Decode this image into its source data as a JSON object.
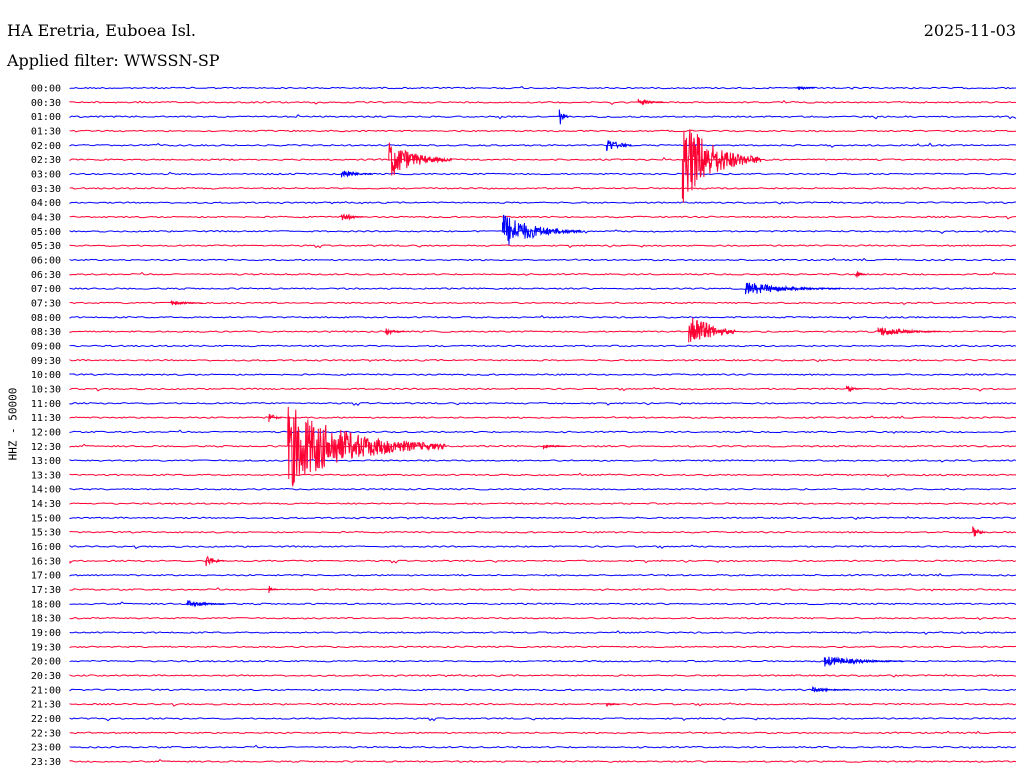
{
  "header": {
    "station": "HA Eretria, Euboea Isl.",
    "date": "2025-11-03",
    "filter": "Applied filter: WWSSN-SP"
  },
  "chart_data": {
    "type": "line",
    "title": "HA Eretria, Euboea Isl.",
    "ylabel": "HHZ - 50000",
    "date": "2025-11-03",
    "filter": "WWSSN-SP",
    "grid": false,
    "colors": {
      "even_rows": "#0000ff",
      "odd_rows": "#ff0033"
    },
    "rows": [
      "00:00",
      "00:30",
      "01:00",
      "01:30",
      "02:00",
      "02:30",
      "03:00",
      "03:30",
      "04:00",
      "04:30",
      "05:00",
      "05:30",
      "06:00",
      "06:30",
      "07:00",
      "07:30",
      "08:00",
      "08:30",
      "09:00",
      "09:30",
      "10:00",
      "10:30",
      "11:00",
      "11:30",
      "12:00",
      "12:30",
      "13:00",
      "13:30",
      "14:00",
      "14:30",
      "15:00",
      "15:30",
      "16:00",
      "16:30",
      "17:00",
      "17:30",
      "18:00",
      "18:30",
      "19:00",
      "19:30",
      "20:00",
      "20:30",
      "21:00",
      "21:30",
      "22:00",
      "22:30",
      "23:00",
      "23:30"
    ],
    "row_minutes": 30,
    "events": [
      {
        "row": "00:30",
        "minute": 18.0,
        "amp": 0.3,
        "dur": 0.8
      },
      {
        "row": "01:00",
        "minute": 15.5,
        "amp": 0.7,
        "dur": 0.3
      },
      {
        "row": "00:00",
        "minute": 23.0,
        "amp": 0.2,
        "dur": 0.6
      },
      {
        "row": "02:00",
        "minute": 17.0,
        "amp": 0.6,
        "dur": 0.8
      },
      {
        "row": "02:30",
        "minute": 10.1,
        "amp": 1.4,
        "dur": 2.0
      },
      {
        "row": "02:30",
        "minute": 19.4,
        "amp": 3.2,
        "dur": 2.5
      },
      {
        "row": "03:00",
        "minute": 8.6,
        "amp": 0.4,
        "dur": 1.0
      },
      {
        "row": "04:30",
        "minute": 8.6,
        "amp": 0.4,
        "dur": 0.7
      },
      {
        "row": "05:00",
        "minute": 13.7,
        "amp": 1.3,
        "dur": 2.5
      },
      {
        "row": "06:30",
        "minute": 24.9,
        "amp": 0.3,
        "dur": 0.3
      },
      {
        "row": "07:00",
        "minute": 21.4,
        "amp": 0.5,
        "dur": 3.0
      },
      {
        "row": "07:30",
        "minute": 3.2,
        "amp": 0.2,
        "dur": 1.0
      },
      {
        "row": "08:30",
        "minute": 19.6,
        "amp": 1.7,
        "dur": 1.5
      },
      {
        "row": "08:30",
        "minute": 25.6,
        "amp": 0.4,
        "dur": 2.0
      },
      {
        "row": "08:30",
        "minute": 10.0,
        "amp": 0.3,
        "dur": 0.6
      },
      {
        "row": "10:30",
        "minute": 24.6,
        "amp": 0.3,
        "dur": 0.5
      },
      {
        "row": "11:30",
        "minute": 6.3,
        "amp": 0.4,
        "dur": 0.4
      },
      {
        "row": "12:30",
        "minute": 6.9,
        "amp": 3.0,
        "dur": 5.0
      },
      {
        "row": "12:30",
        "minute": 15.0,
        "amp": 0.2,
        "dur": 0.7
      },
      {
        "row": "15:30",
        "minute": 28.6,
        "amp": 0.5,
        "dur": 0.4
      },
      {
        "row": "16:30",
        "minute": 4.3,
        "amp": 0.5,
        "dur": 0.6
      },
      {
        "row": "17:30",
        "minute": 6.3,
        "amp": 0.3,
        "dur": 0.3
      },
      {
        "row": "18:00",
        "minute": 3.7,
        "amp": 0.3,
        "dur": 1.2
      },
      {
        "row": "20:00",
        "minute": 23.9,
        "amp": 0.4,
        "dur": 2.5
      },
      {
        "row": "21:00",
        "minute": 23.5,
        "amp": 0.2,
        "dur": 1.2
      },
      {
        "row": "21:30",
        "minute": 17.0,
        "amp": 0.15,
        "dur": 0.4
      }
    ]
  }
}
